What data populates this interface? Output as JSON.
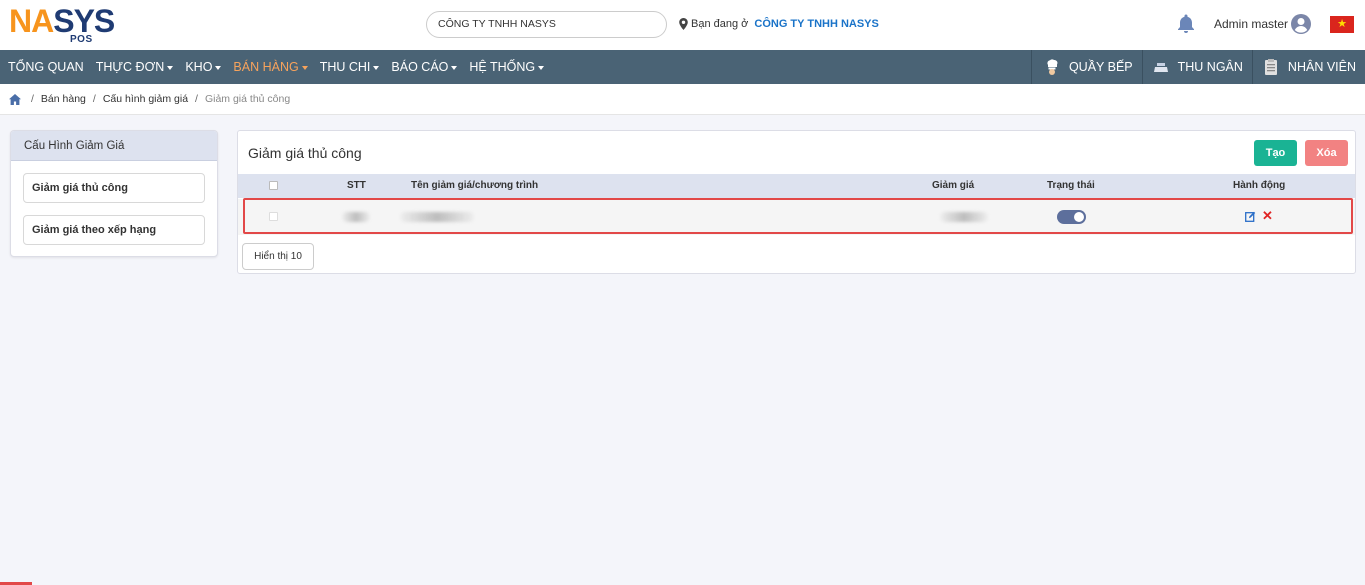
{
  "brand": {
    "logo_na": "NA",
    "logo_sys": "SYS",
    "logo_pos": "POS"
  },
  "header": {
    "company_select": "CÔNG TY TNHH NASYS",
    "location_prefix": "Bạn đang ở",
    "location_company": "CÔNG TY TNHH NASYS",
    "user_name": "Admin master",
    "flag_icon": "vietnam-flag-icon"
  },
  "nav": {
    "items": [
      {
        "label": "TỔNG QUAN",
        "dropdown": false,
        "active": false
      },
      {
        "label": "THỰC ĐƠN",
        "dropdown": true,
        "active": false
      },
      {
        "label": "KHO",
        "dropdown": true,
        "active": false
      },
      {
        "label": "BÁN HÀNG",
        "dropdown": true,
        "active": true
      },
      {
        "label": "THU CHI",
        "dropdown": true,
        "active": false
      },
      {
        "label": "BÁO CÁO",
        "dropdown": true,
        "active": false
      },
      {
        "label": "HỆ THỐNG",
        "dropdown": true,
        "active": false
      }
    ],
    "right": {
      "kitchen": "QUẦY BẾP",
      "cashier": "THU NGÂN",
      "staff": "NHÂN VIÊN"
    }
  },
  "breadcrumb": {
    "sep": "/",
    "item1": "Bán hàng",
    "item2": "Cấu hình giảm giá",
    "current": "Giảm giá thủ công"
  },
  "sidebar": {
    "title": "Cấu Hình Giảm Giá",
    "item1": "Giảm giá thủ công",
    "item2": "Giảm giá theo xếp hạng"
  },
  "panel": {
    "title": "Giảm giá thủ công",
    "create_label": "Tạo",
    "delete_label": "Xóa",
    "columns": {
      "stt": "STT",
      "name": "Tên giảm giá/chương trình",
      "discount": "Giảm giá",
      "status": "Trạng thái",
      "actions": "Hành động"
    },
    "row": {
      "status_on": true,
      "delete_glyph": "✕"
    },
    "page_size": "Hiển thị 10"
  },
  "colors": {
    "nav_bg": "#4a6375",
    "nav_active": "#f7a35c",
    "create": "#1ab394",
    "delete": "#f28282",
    "highlight": "#e24848"
  }
}
